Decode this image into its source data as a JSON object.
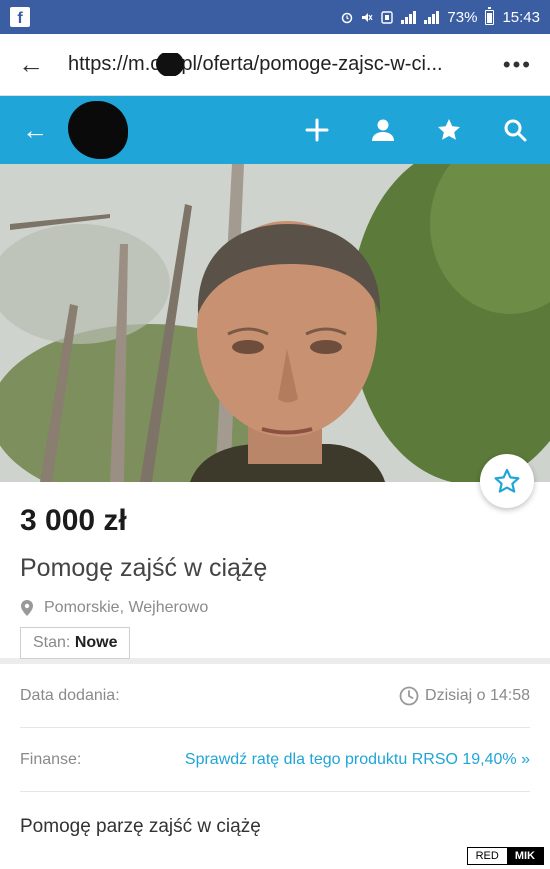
{
  "status_bar": {
    "app_icon": "facebook-icon",
    "battery_percent": "73%",
    "time": "15:43"
  },
  "browser": {
    "url": "https://m.olx.pl/oferta/pomoge-zajsc-w-ci...",
    "menu_icon": "more-vert-icon",
    "back_icon": "back-arrow-icon"
  },
  "app_header": {
    "background": "#1fa5d8",
    "back_icon": "back-arrow-icon",
    "actions": [
      "add-icon",
      "user-icon",
      "star-icon",
      "search-icon"
    ]
  },
  "listing": {
    "price": "3 000 zł",
    "title": "Pomogę zajść w ciążę",
    "location": "Pomorskie, Wejherowo",
    "state_label": "Stan:",
    "state_value": "Nowe"
  },
  "info": {
    "added_label": "Data dodania:",
    "added_value": "Dzisiaj o 14:58",
    "finance_label": "Finanse:",
    "finance_link": "Sprawdź ratę dla tego produktu RRSO 19,40% »",
    "description": "Pomogę parzę zajść w ciążę"
  },
  "watermark": {
    "left": "RED",
    "right": "MIK"
  }
}
